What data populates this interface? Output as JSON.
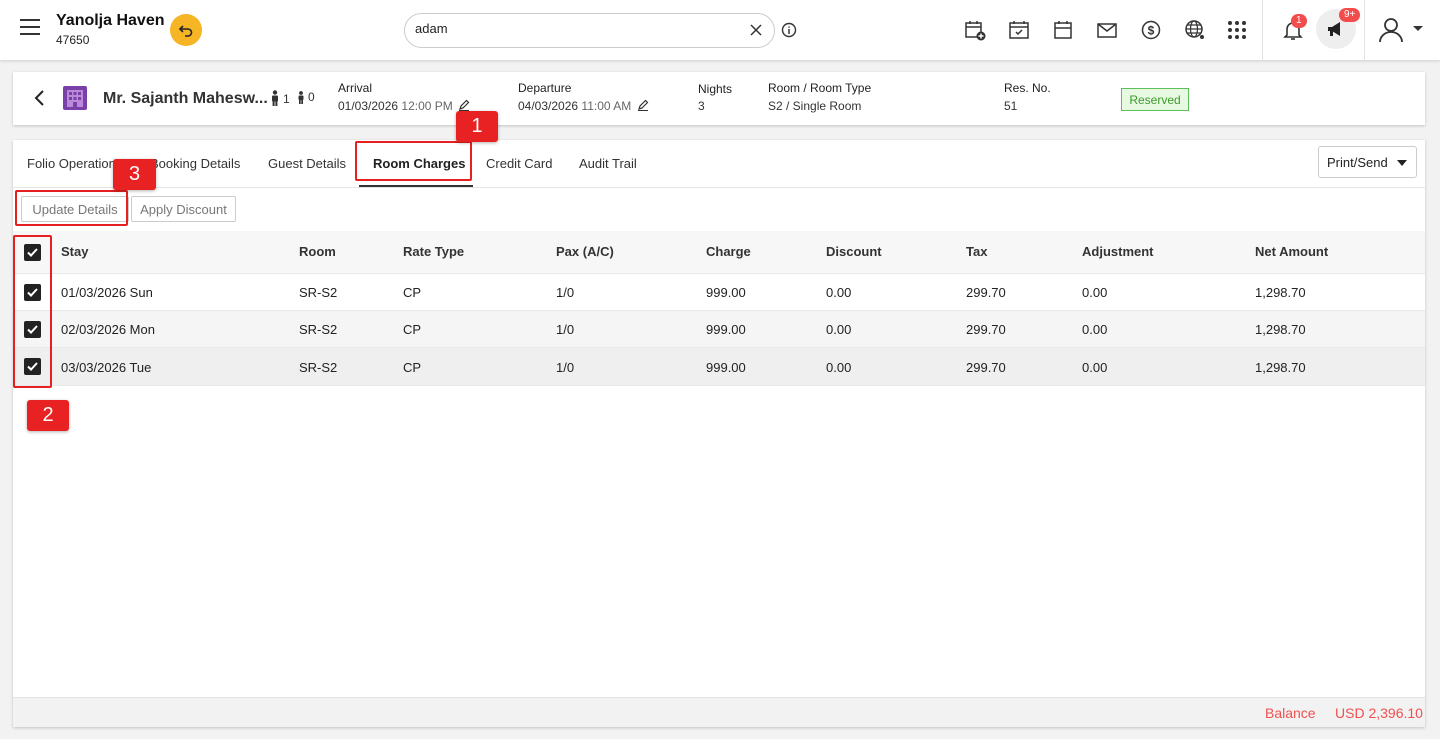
{
  "app": {
    "hotel_name": "Yanolja Haven",
    "hotel_id": "47650"
  },
  "search": {
    "value": "adam"
  },
  "notifications": {
    "count": "1",
    "announcements": "9+"
  },
  "icons": [
    "menu-icon",
    "undo-icon",
    "clear-icon",
    "info-icon",
    "calendar-add-icon",
    "calendar-check-icon",
    "calendar-icon",
    "mail-icon",
    "dollar-icon",
    "globe-icon",
    "apps-grid-icon",
    "bell-icon",
    "megaphone-icon",
    "user-icon"
  ],
  "reservation": {
    "guest_name": "Mr. Sajanth Mahesw...",
    "adults": "1",
    "children": "0",
    "arrival_label": "Arrival",
    "arrival_date": "01/03/2026",
    "arrival_time": "12:00 PM",
    "departure_label": "Departure",
    "departure_date": "04/03/2026",
    "departure_time": "11:00 AM",
    "nights_label": "Nights",
    "nights": "3",
    "room_label": "Room / Room Type",
    "room": "S2 / Single Room",
    "resno_label": "Res. No.",
    "resno": "51",
    "status": "Reserved"
  },
  "tabs": [
    "Folio Operations",
    "Booking Details",
    "Guest Details",
    "Room Charges",
    "Credit Card",
    "Audit Trail"
  ],
  "print_send": "Print/Send",
  "actions": {
    "update": "Update Details",
    "discount": "Apply Discount"
  },
  "table": {
    "columns": [
      "Stay",
      "Room",
      "Rate Type",
      "Pax (A/C)",
      "Charge",
      "Discount",
      "Tax",
      "Adjustment",
      "Net Amount"
    ],
    "rows": [
      [
        "01/03/2026 Sun",
        "SR-S2",
        "CP",
        "1/0",
        "999.00",
        "0.00",
        "299.70",
        "0.00",
        "1,298.70"
      ],
      [
        "02/03/2026 Mon",
        "SR-S2",
        "CP",
        "1/0",
        "999.00",
        "0.00",
        "299.70",
        "0.00",
        "1,298.70"
      ],
      [
        "03/03/2026 Tue",
        "SR-S2",
        "CP",
        "1/0",
        "999.00",
        "0.00",
        "299.70",
        "0.00",
        "1,298.70"
      ]
    ]
  },
  "balance": {
    "label": "Balance",
    "value": "USD 2,396.10"
  },
  "annotations": [
    "1",
    "2",
    "3"
  ],
  "colors": {
    "accent": "#f5b524",
    "status_green": "#3a9b2a",
    "highlight_red": "#e52020",
    "balance_red": "#f05050"
  }
}
